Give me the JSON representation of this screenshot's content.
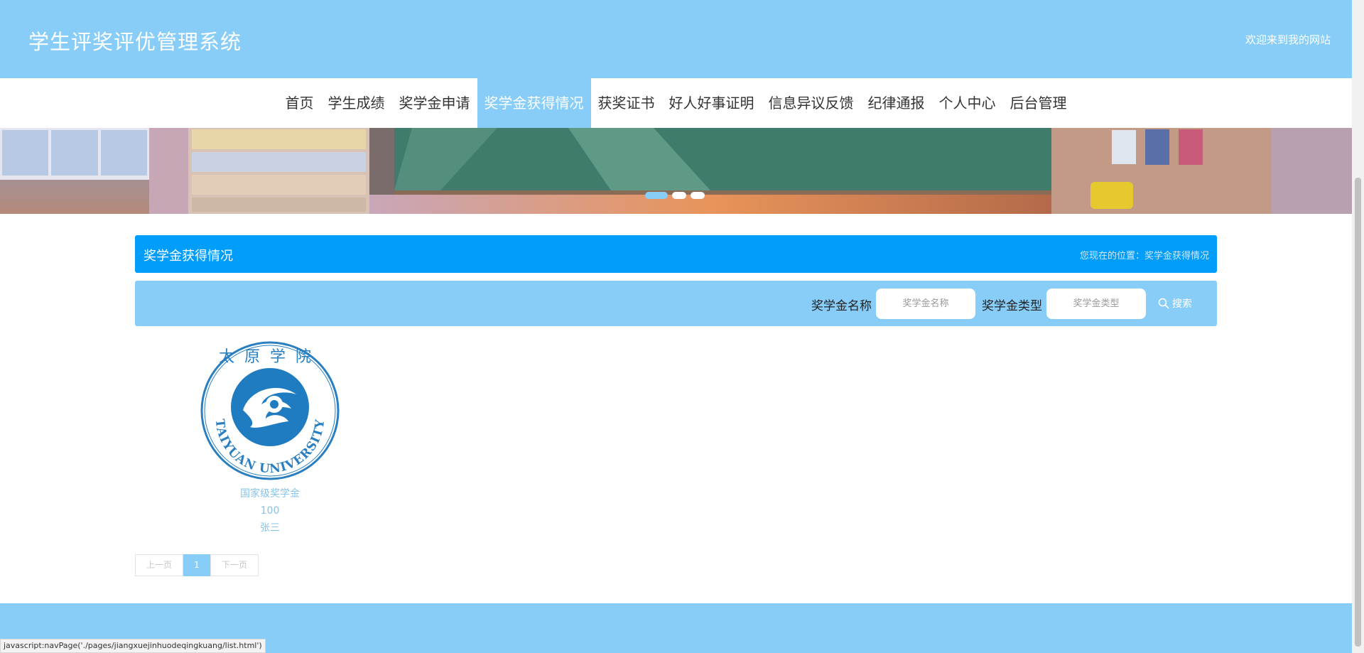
{
  "header": {
    "title": "学生评奖评优管理系统",
    "welcome": "欢迎来到我的网站"
  },
  "nav": {
    "items": [
      {
        "label": "首页"
      },
      {
        "label": "学生成绩"
      },
      {
        "label": "奖学金申请"
      },
      {
        "label": "奖学金获得情况"
      },
      {
        "label": "获奖证书"
      },
      {
        "label": "好人好事证明"
      },
      {
        "label": "信息异议反馈"
      },
      {
        "label": "纪律通报"
      },
      {
        "label": "个人中心"
      },
      {
        "label": "后台管理"
      }
    ],
    "active_index": 3
  },
  "section": {
    "title": "奖学金获得情况",
    "breadcrumb": "您现在的位置：奖学金获得情况"
  },
  "search": {
    "name_label": "奖学金名称",
    "name_placeholder": "奖学金名称",
    "type_label": "奖学金类型",
    "type_placeholder": "奖学金类型",
    "button_label": "搜索",
    "button_icon": "search-icon"
  },
  "results": [
    {
      "logo_text": "TAIYUAN UNIVERSITY",
      "logo_cn": "太原学院",
      "name": "国家级奖学金",
      "amount": "100",
      "student": "张三"
    }
  ],
  "pager": {
    "prev": "上一页",
    "current": "1",
    "next": "下一页"
  },
  "statusbar": {
    "url": "javascript:navPage('./pages/jiangxuejinhuodeqingkuang/list.html')"
  },
  "colors": {
    "primary": "#87cdf8",
    "section_bar": "#009dfb",
    "footer": "#87cdf8"
  }
}
